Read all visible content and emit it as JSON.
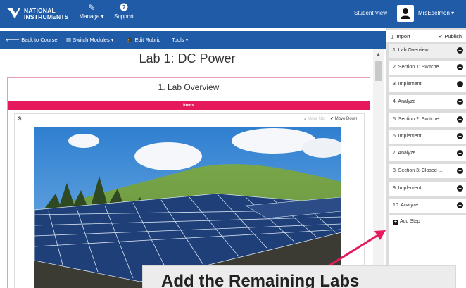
{
  "navbar": {
    "logo_line1": "NATIONAL",
    "logo_line2": "INSTRUMENTS",
    "manage_label": "Manage ▾",
    "support_label": "Support",
    "student_view_label": "Student View",
    "user_label": "MrsEdelmon ▾"
  },
  "toolbar": {
    "back_label": "Back to Course",
    "switch_modules_label": "Switch Modules ▾",
    "edit_rubric_label": "Edit Rubric",
    "tools_label": "Tools ▾"
  },
  "main": {
    "lab_title": "Lab 1: DC Power",
    "step_title": "1. Lab Overview",
    "items_label": "Items",
    "move_up_label": "Move Up",
    "move_down_label": "Move Down"
  },
  "panel": {
    "import_label": "Import",
    "publish_label": "Publish",
    "steps": [
      {
        "label": "1. Lab Overview"
      },
      {
        "label": "2. Section 1: Switche..."
      },
      {
        "label": "3. Implement"
      },
      {
        "label": "4. Analyze"
      },
      {
        "label": "5. Section 2: Switche..."
      },
      {
        "label": "6. Implement"
      },
      {
        "label": "7. Analyze"
      },
      {
        "label": "8. Section 3: Closed-..."
      },
      {
        "label": "9. Implement"
      },
      {
        "label": "10. Analyze"
      }
    ],
    "active_index": 0,
    "add_step_label": "Add Step"
  },
  "callout": {
    "text": "Add the Remaining Labs"
  },
  "colors": {
    "nav_blue": "#1f5ba6",
    "items_pink": "#e6195d",
    "arrow": "#e6195d"
  },
  "icons": [
    "pencil-icon",
    "question-icon",
    "person-icon",
    "back-arrow-icon",
    "modules-icon",
    "graduation-cap-icon",
    "import-icon",
    "check-icon",
    "plus-circle-icon",
    "gear-icon"
  ]
}
